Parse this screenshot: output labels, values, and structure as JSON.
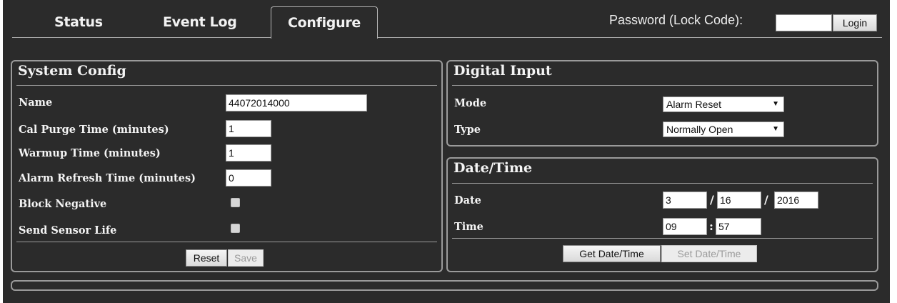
{
  "tabs": [
    {
      "label": "Status",
      "active": false
    },
    {
      "label": "Event Log",
      "active": false
    },
    {
      "label": "Configure",
      "active": true
    }
  ],
  "login": {
    "label": "Password (Lock Code):",
    "password_value": "",
    "button_label": "Login"
  },
  "system_config": {
    "title": "System Config",
    "fields": {
      "name": {
        "label": "Name",
        "value": "44072014000"
      },
      "cal_purge": {
        "label": "Cal Purge Time (minutes)",
        "value": "1"
      },
      "warmup": {
        "label": "Warmup Time (minutes)",
        "value": "1"
      },
      "alarm_refresh": {
        "label": "Alarm Refresh Time (minutes)",
        "value": "0"
      },
      "block_negative": {
        "label": "Block Negative",
        "checked": false
      },
      "send_sensor_life": {
        "label": "Send Sensor Life",
        "checked": false
      }
    },
    "reset_label": "Reset",
    "save_label": "Save"
  },
  "digital_input": {
    "title": "Digital Input",
    "mode": {
      "label": "Mode",
      "selected": "Alarm Reset"
    },
    "type": {
      "label": "Type",
      "selected": "Normally Open"
    }
  },
  "date_time": {
    "title": "Date/Time",
    "date": {
      "label": "Date",
      "month": "3",
      "day": "16",
      "year": "2016",
      "separator": "/"
    },
    "time": {
      "label": "Time",
      "hour": "09",
      "minute": "57",
      "separator": ":"
    },
    "get_label": "Get Date/Time",
    "set_label": "Set Date/Time"
  },
  "colors": {
    "background": "#2b2b2b",
    "border": "#9a9a9a",
    "text": "#f4f4f4"
  }
}
